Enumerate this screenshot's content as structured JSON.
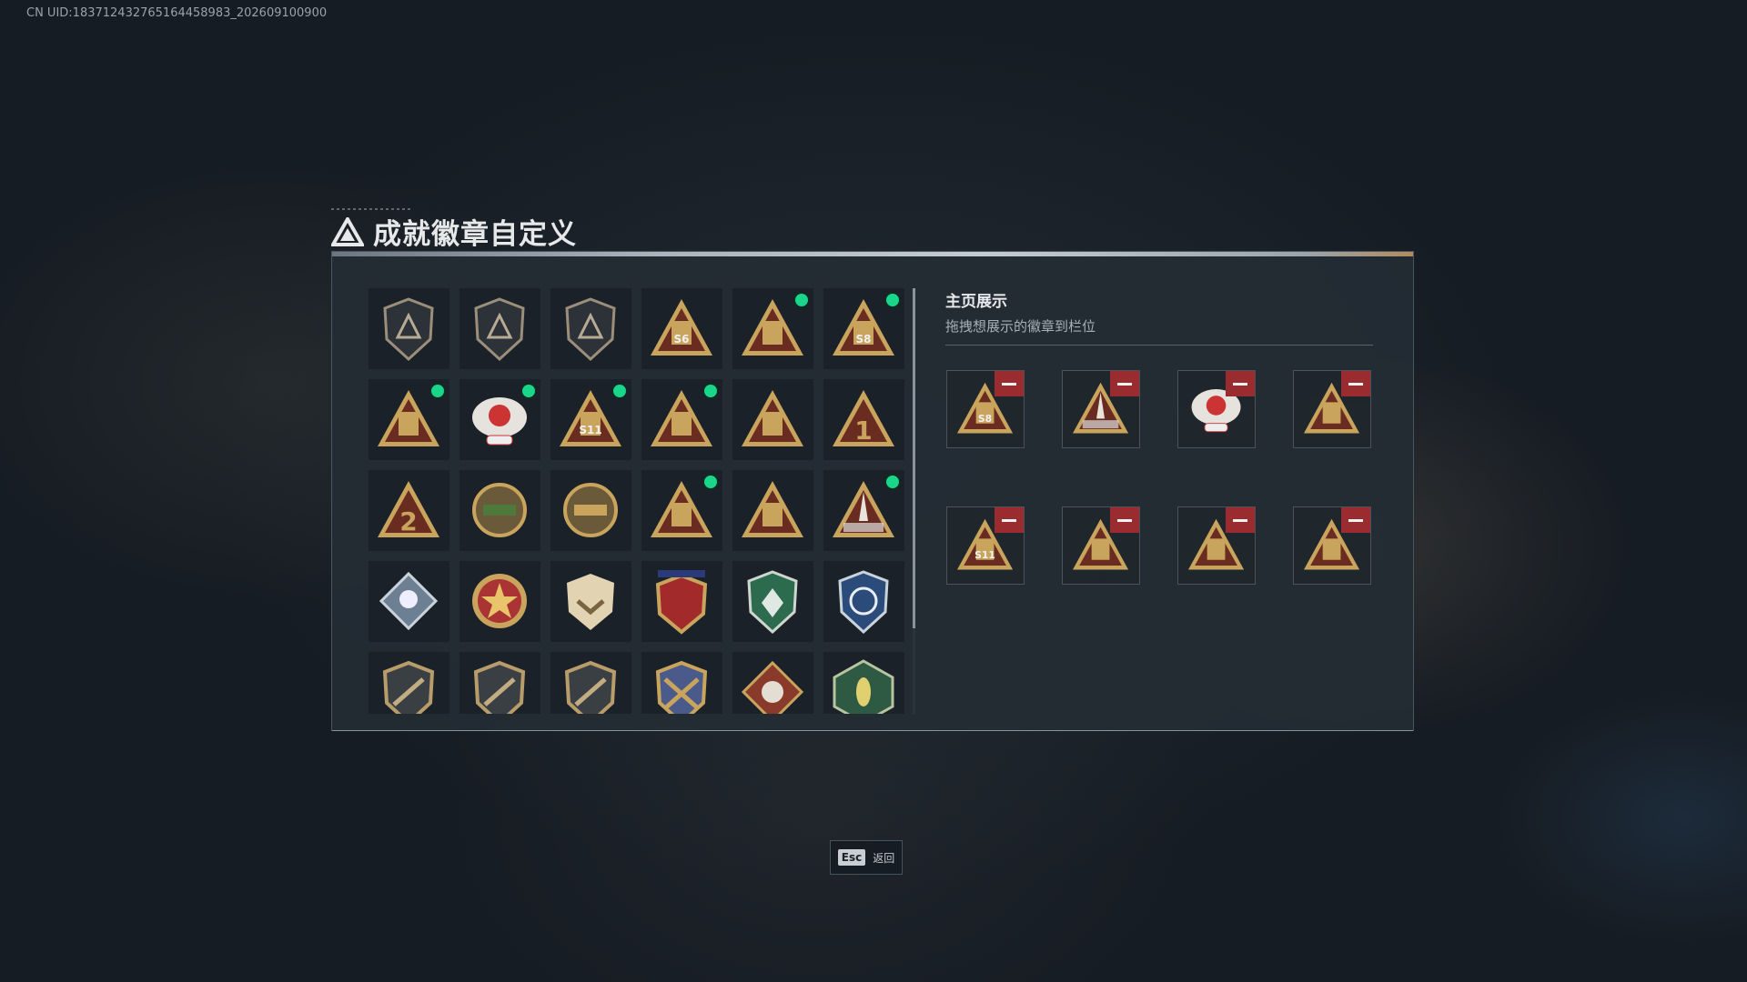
{
  "uid_text": "CN UID:183712432765164458983_202609100900",
  "title": "成就徽章自定义",
  "showcase": {
    "title": "主页展示",
    "subtitle": "拖拽想展示的徽章到栏位"
  },
  "footer": {
    "key": "Esc",
    "label": "返回"
  },
  "colors": {
    "new_dot": "#19d68b",
    "remove_button": "#9a2b2f",
    "panel_bg": "#242c34",
    "gold": "#c9a45c",
    "maroon": "#6a2c20"
  },
  "badges": [
    {
      "icon": "triangle-shield-icon",
      "text": "",
      "new": false
    },
    {
      "icon": "helicopter-shield-icon",
      "text": "",
      "new": false
    },
    {
      "icon": "wings-shield-icon",
      "text": "",
      "new": false
    },
    {
      "icon": "gold-triangle-s6-icon",
      "text": "S6",
      "new": false
    },
    {
      "icon": "gold-triangle-tower-icon",
      "text": "",
      "new": true
    },
    {
      "icon": "gold-triangle-s8-icon",
      "text": "S8",
      "new": true
    },
    {
      "icon": "gold-triangle-stars-icon",
      "text": "",
      "new": true
    },
    {
      "icon": "eagle-crest-icon",
      "text": "",
      "new": true
    },
    {
      "icon": "gold-triangle-s11-icon",
      "text": "S11",
      "new": true
    },
    {
      "icon": "gold-triangle-bear-icon",
      "text": "",
      "new": true
    },
    {
      "icon": "gold-triangle-dove-icon",
      "text": "",
      "new": false
    },
    {
      "icon": "gold-triangle-rank-1-icon",
      "text": "1",
      "new": false
    },
    {
      "icon": "gold-triangle-rank-2-icon",
      "text": "2",
      "new": false
    },
    {
      "icon": "crocodile-emblem-icon",
      "text": "",
      "new": false
    },
    {
      "icon": "round-emblem-icon",
      "text": "",
      "new": false
    },
    {
      "icon": "gold-triangle-block-icon",
      "text": "",
      "new": true
    },
    {
      "icon": "gold-triangle-beasts-icon",
      "text": "",
      "new": false
    },
    {
      "icon": "gold-triangle-rocket-icon",
      "text": "",
      "new": true
    },
    {
      "icon": "diamond-rose-icon",
      "text": "",
      "new": false
    },
    {
      "icon": "star-medal-icon",
      "text": "",
      "new": false
    },
    {
      "icon": "shield-chevron-icon",
      "text": "",
      "new": false
    },
    {
      "icon": "crown-shield-icon",
      "text": "",
      "new": false
    },
    {
      "icon": "green-shield-icon",
      "text": "",
      "new": false
    },
    {
      "icon": "sniper-shield-icon",
      "text": "",
      "new": false
    },
    {
      "icon": "rifle-badge-icon",
      "text": "",
      "new": false
    },
    {
      "icon": "rifle-badge-icon",
      "text": "",
      "new": false
    },
    {
      "icon": "rifle-badge-icon",
      "text": "",
      "new": false
    },
    {
      "icon": "crossed-guns-shield-icon",
      "text": "",
      "new": false
    },
    {
      "icon": "wolf-diamond-icon",
      "text": "",
      "new": false
    },
    {
      "icon": "hornet-badge-icon",
      "text": "",
      "new": false
    }
  ],
  "showcase_slots": [
    {
      "icon": "gold-triangle-s8-icon",
      "text": "S8"
    },
    {
      "icon": "gold-triangle-rocket-icon",
      "text": ""
    },
    {
      "icon": "eagle-crest-icon",
      "text": ""
    },
    {
      "icon": "gold-triangle-block-icon",
      "text": ""
    },
    {
      "icon": "gold-triangle-s11-icon",
      "text": "S11"
    },
    {
      "icon": "gold-triangle-stars-icon",
      "text": ""
    },
    {
      "icon": "gold-triangle-tower-icon",
      "text": ""
    },
    {
      "icon": "gold-triangle-bear-icon",
      "text": ""
    }
  ]
}
